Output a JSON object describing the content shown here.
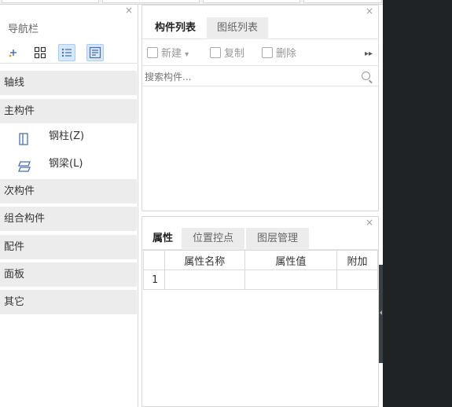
{
  "nav": {
    "title": "导航栏",
    "close_label": "×",
    "toolbar_icons": [
      "add-icon",
      "grid-icon",
      "list-icon",
      "detail-icon"
    ],
    "categories": [
      {
        "label": "轴线"
      },
      {
        "label": "主构件"
      },
      {
        "label": "次构件"
      },
      {
        "label": "组合构件"
      },
      {
        "label": "配件"
      },
      {
        "label": "面板"
      },
      {
        "label": "其它"
      }
    ],
    "sub_items": [
      {
        "label": "钢柱(Z)",
        "icon": "steel-column-icon"
      },
      {
        "label": "钢梁(L)",
        "icon": "steel-beam-icon"
      }
    ]
  },
  "component_panel": {
    "close_label": "×",
    "tabs": [
      {
        "label": "构件列表",
        "active": true
      },
      {
        "label": "图纸列表",
        "active": false
      }
    ],
    "toolbar": {
      "new_label": "新建",
      "copy_label": "复制",
      "delete_label": "删除",
      "more_label": "▸▸",
      "dropdown_label": "▾"
    },
    "search": {
      "placeholder": "搜索构件..."
    }
  },
  "property_panel": {
    "close_label": "×",
    "tabs": [
      {
        "label": "属性",
        "active": true
      },
      {
        "label": "位置控点",
        "active": false
      },
      {
        "label": "图层管理",
        "active": false
      }
    ],
    "table": {
      "headers": [
        "",
        "属性名称",
        "属性值",
        "附加"
      ],
      "rows": [
        {
          "index": "1",
          "name": "",
          "value": "",
          "extra": ""
        }
      ]
    }
  },
  "colors": {
    "accent_active_bg": "#d6e8fb",
    "category_bg": "#ececec",
    "dark_area": "#1f2326",
    "icon_blue": "#4a6fa5"
  }
}
